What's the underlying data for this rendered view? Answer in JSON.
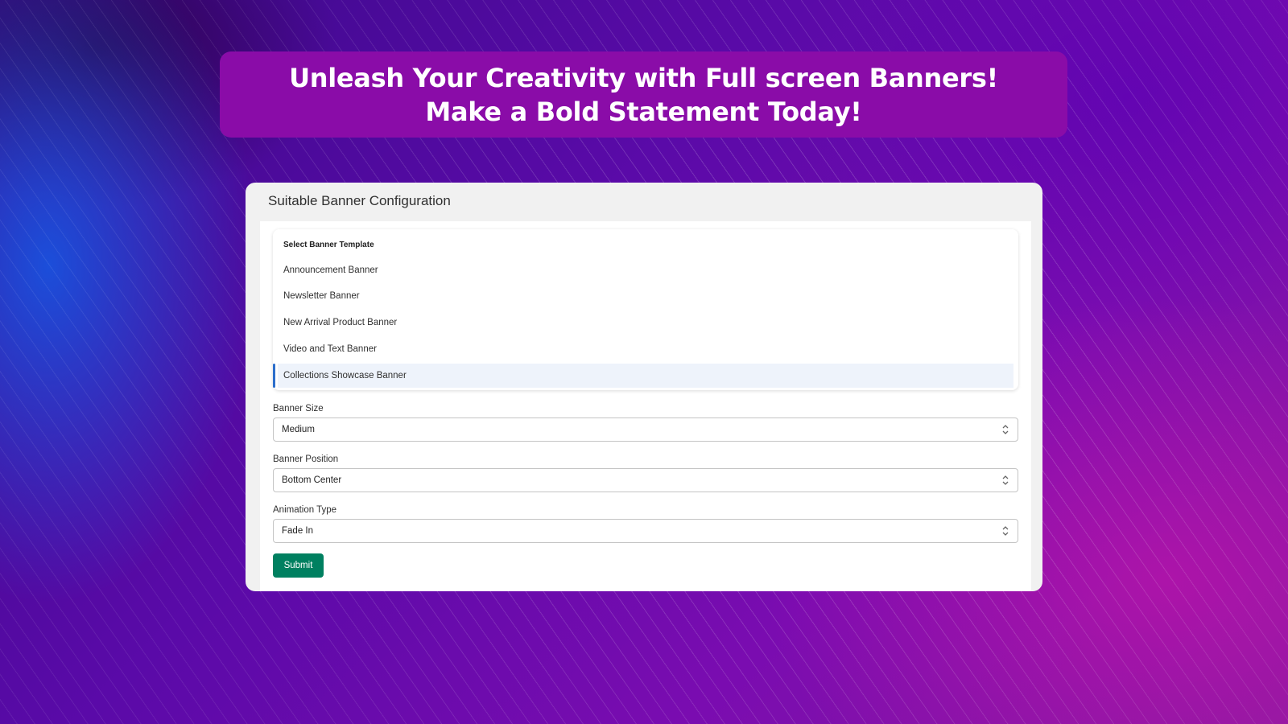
{
  "hero": {
    "title": "Unleash Your Creativity with Full screen Banners! Make a Bold Statement Today!"
  },
  "card": {
    "title": "Suitable Banner Configuration",
    "template_list": {
      "heading": "Select Banner Template",
      "options": [
        "Announcement Banner",
        "Newsletter Banner",
        "New Arrival Product Banner",
        "Video and Text Banner",
        "Collections Showcase Banner"
      ],
      "selected": "Collections Showcase Banner"
    },
    "banner_size": {
      "label": "Banner Size",
      "value": "Medium"
    },
    "banner_position": {
      "label": "Banner Position",
      "value": "Bottom Center"
    },
    "animation_type": {
      "label": "Animation Type",
      "value": "Fade In"
    },
    "submit_label": "Submit"
  },
  "colors": {
    "hero_bg": "#8a0ca8",
    "submit": "#008060",
    "selected_accent": "#2c6ecb"
  }
}
